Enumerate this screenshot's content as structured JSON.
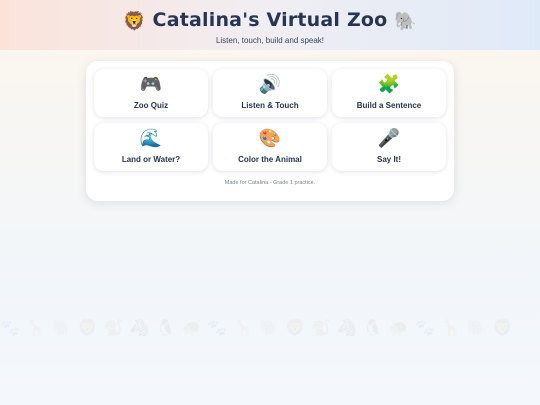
{
  "header": {
    "title_emoji_left": "🦁",
    "title": "Catalina's Virtual Zoo",
    "title_emoji_right": "🐘",
    "subtitle": "Listen, touch, build and speak!"
  },
  "activities": [
    {
      "icon": "🎮",
      "icon_name": "game-controller-icon",
      "label": "Zoo Quiz"
    },
    {
      "icon": "🔊",
      "icon_name": "speaker-icon",
      "label": "Listen & Touch"
    },
    {
      "icon": "🧩",
      "icon_name": "puzzle-piece-icon",
      "label": "Build a Sentence"
    },
    {
      "icon": "🌊",
      "icon_name": "wave-icon",
      "label": "Land or Water?"
    },
    {
      "icon": "🎨",
      "icon_name": "palette-icon",
      "label": "Color the Animal"
    },
    {
      "icon": "🎤",
      "icon_name": "microphone-icon",
      "label": "Say It!"
    }
  ],
  "footer": {
    "note": "Made for Catalina - Grade 1 practice."
  },
  "colors": {
    "title_text": "#263553",
    "header_left": "#fbe3da",
    "header_right": "#dfeaf8",
    "card_bg": "#ffffff"
  }
}
